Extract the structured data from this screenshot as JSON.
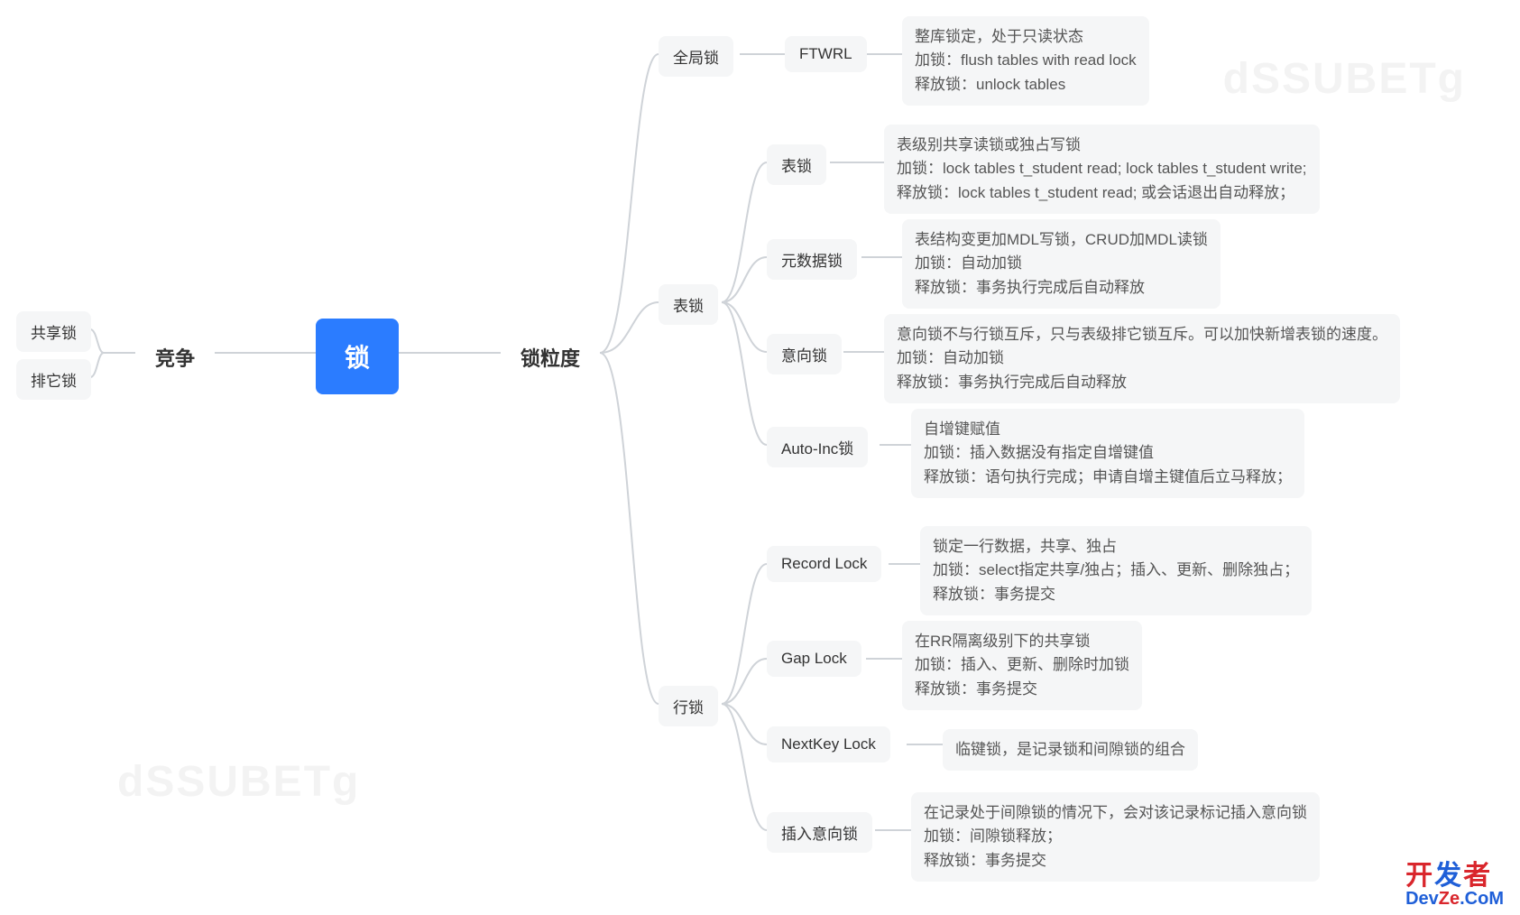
{
  "watermark": "dSSUBETg",
  "root": {
    "label": "锁"
  },
  "left": {
    "l1": "竞争",
    "leaves": [
      "共享锁",
      "排它锁"
    ]
  },
  "right": {
    "l1": "锁粒度",
    "global": {
      "label": "全局锁",
      "ftwrl_label": "FTWRL",
      "ftwrl_detail": "整库锁定，处于只读状态\n加锁：flush tables with read lock\n释放锁：unlock tables"
    },
    "table": {
      "label": "表锁",
      "children": [
        {
          "label": "表锁",
          "detail": "表级别共享读锁或独占写锁\n加锁：lock tables t_student read; lock tables t_student write;\n释放锁：lock tables t_student read; 或会话退出自动释放；"
        },
        {
          "label": "元数据锁",
          "detail": "表结构变更加MDL写锁，CRUD加MDL读锁\n加锁：自动加锁\n释放锁：事务执行完成后自动释放"
        },
        {
          "label": "意向锁",
          "detail": "意向锁不与行锁互斥，只与表级排它锁互斥。可以加快新增表锁的速度。\n加锁：自动加锁\n释放锁：事务执行完成后自动释放"
        },
        {
          "label": "Auto-Inc锁",
          "detail": "自增键赋值\n加锁：插入数据没有指定自增键值\n释放锁：语句执行完成；申请自增主键值后立马释放；"
        }
      ]
    },
    "row": {
      "label": "行锁",
      "children": [
        {
          "label": "Record Lock",
          "detail": "锁定一行数据，共享、独占\n加锁：select指定共享/独占；插入、更新、删除独占；\n释放锁：事务提交"
        },
        {
          "label": "Gap Lock",
          "detail": "在RR隔离级别下的共享锁\n加锁：插入、更新、删除时加锁\n释放锁：事务提交"
        },
        {
          "label": "NextKey Lock",
          "detail": "临键锁，是记录锁和间隙锁的组合"
        },
        {
          "label": "插入意向锁",
          "detail": "在记录处于间隙锁的情况下，会对该记录标记插入意向锁\n加锁：间隙锁释放；\n释放锁：事务提交"
        }
      ]
    }
  },
  "logo": {
    "line1_r": "开",
    "line1_b": "发",
    "line1_r2": "者",
    "line2": "DevZe.CoM"
  }
}
